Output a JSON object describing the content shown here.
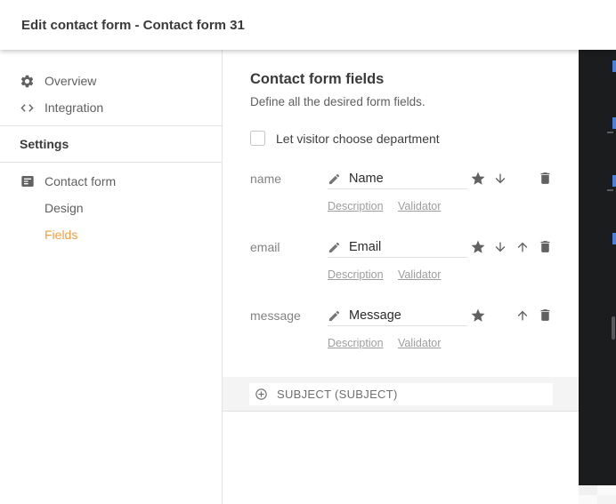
{
  "header": {
    "title": "Edit contact form - Contact form 31"
  },
  "sidebar": {
    "items": [
      {
        "label": "Overview",
        "icon": "gear-icon"
      },
      {
        "label": "Integration",
        "icon": "code-icon"
      }
    ],
    "section_label": "Settings",
    "settings_items": [
      {
        "label": "Contact form",
        "icon": "form-icon"
      },
      {
        "label": "Design"
      },
      {
        "label": "Fields",
        "active": true
      }
    ]
  },
  "main": {
    "title": "Contact form fields",
    "subtitle": "Define all the desired form fields.",
    "checkbox": {
      "label": "Let visitor choose department",
      "checked": false
    },
    "fields": [
      {
        "key": "name",
        "label": "Name",
        "actions": [
          "favorite",
          "move-down",
          "delete"
        ]
      },
      {
        "key": "email",
        "label": "Email",
        "actions": [
          "favorite",
          "move-down",
          "move-up",
          "delete"
        ]
      },
      {
        "key": "message",
        "label": "Message",
        "actions": [
          "favorite",
          "move-up",
          "delete"
        ]
      }
    ],
    "row_links": {
      "description": "Description",
      "validator": "Validator"
    },
    "add_field_bar": {
      "label": "SUBJECT (SUBJECT)",
      "icon": "add-circle-icon"
    }
  },
  "colors": {
    "accent_orange": "#F89B3C",
    "icon_gray": "#616161",
    "backdrop_dark": "#1b1c1e",
    "link_gray": "#9e9e9e"
  }
}
